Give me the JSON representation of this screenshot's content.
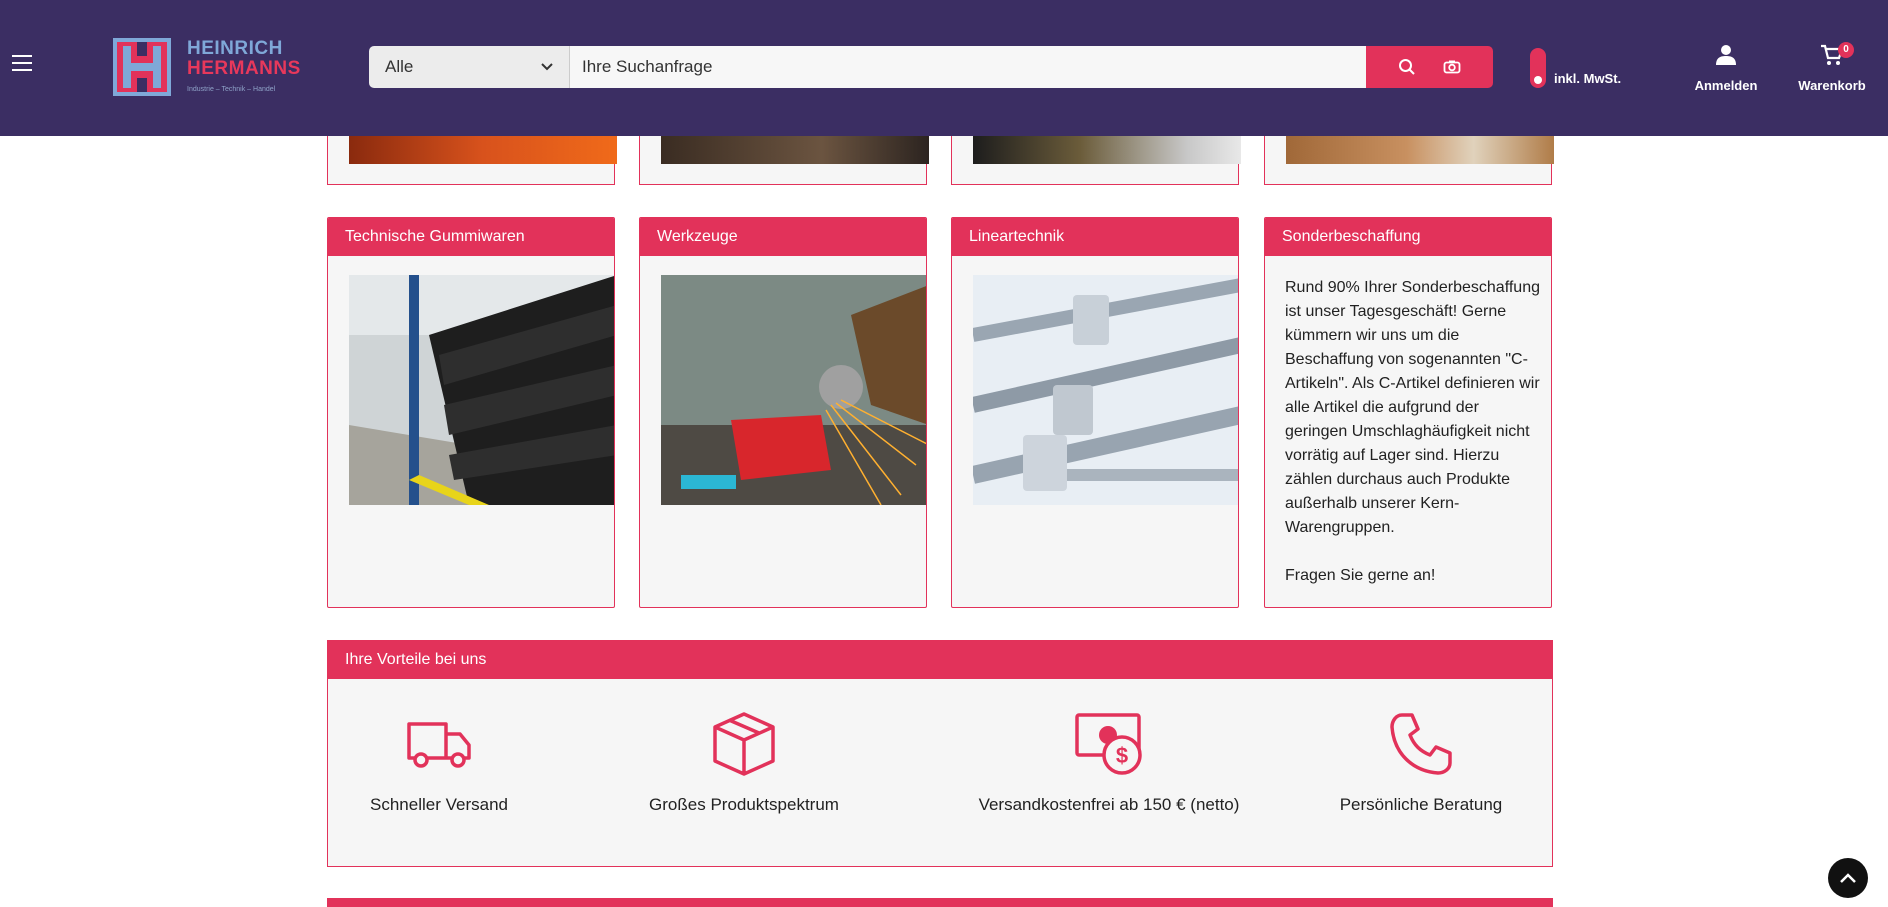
{
  "header": {
    "logo": {
      "line1": "HEINRICH",
      "line2": "HERMANNS",
      "tagline": "Industrie – Technik – Handel"
    },
    "search": {
      "category": "Alle",
      "placeholder": "Ihre Suchanfrage"
    },
    "vat_label": "inkl. MwSt.",
    "login_label": "Anmelden",
    "cart_label": "Warenkorb",
    "cart_count": "0"
  },
  "categories": [
    {
      "title": "Technische Gummiwaren",
      "image": "rubber-goods-warehouse"
    },
    {
      "title": "Werkzeuge",
      "image": "angle-grinder-sparks"
    },
    {
      "title": "Lineartechnik",
      "image": "ball-screws"
    },
    {
      "title": "Sonderbeschaffung",
      "text": "Rund 90% Ihrer Sonderbeschaffung ist unser Tagesgeschäft! Gerne kümmern wir uns um die Beschaffung von sogenannten \"C-Artikeln\". Als C-Artikel definieren wir alle Artikel die aufgrund der geringen Umschlaghäufigkeit nicht vorrätig auf Lager sind. Hierzu zählen durchaus auch Produkte außerhalb unserer Kern-Warengruppen.",
      "cta": "Fragen Sie gerne an!"
    }
  ],
  "vorteile": {
    "title": "Ihre Vorteile bei uns",
    "items": [
      {
        "label": "Schneller Versand",
        "icon": "truck-icon"
      },
      {
        "label": "Großes Produktspektrum",
        "icon": "box-icon"
      },
      {
        "label": "Versandkostenfrei ab 150 € (netto)",
        "icon": "money-icon"
      },
      {
        "label": "Persönliche Beratung",
        "icon": "phone-icon"
      }
    ]
  },
  "colors": {
    "header_bg": "#3b2e63",
    "accent": "#e2325a",
    "card_bg": "#f6f6f6"
  }
}
